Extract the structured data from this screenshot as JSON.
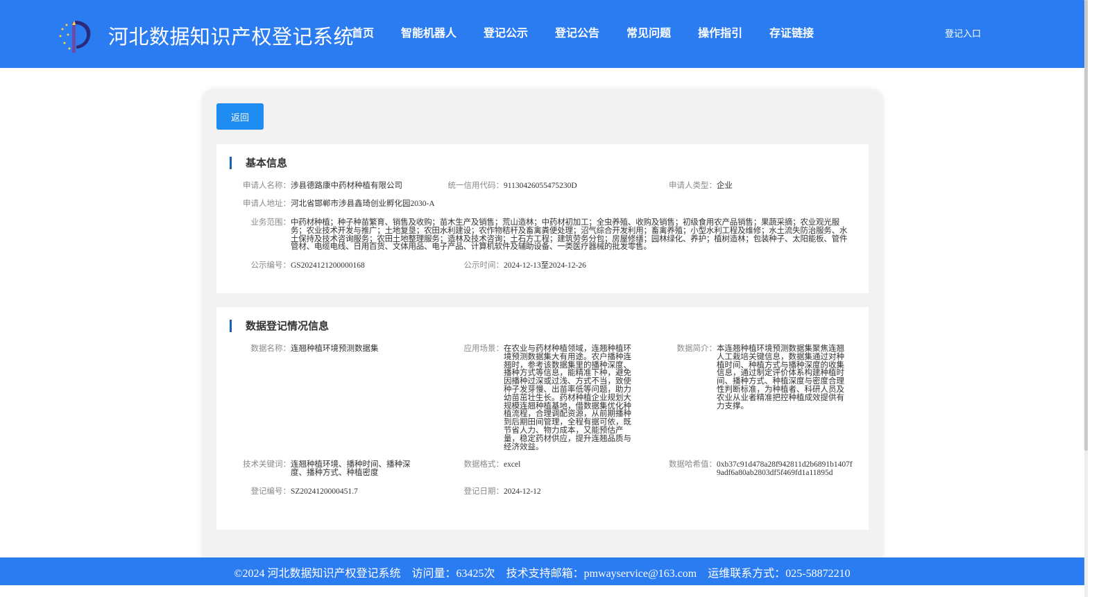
{
  "header": {
    "site_title": "河北数据知识产权登记系统",
    "nav": [
      "首页",
      "智能机器人",
      "登记公示",
      "登记公告",
      "常见问题",
      "操作指引",
      "存证链接"
    ],
    "login": "登记入口",
    "logo_icon": "logo-emblem-icon",
    "brand_color": "#2b7cf0"
  },
  "main": {
    "back_label": "返回",
    "basic": {
      "title": "基本信息",
      "applicant_name_label": "申请人名称：",
      "applicant_name": "涉县德路康中药材种植有限公司",
      "credit_code_label": "统一信用代码：",
      "credit_code": "91130426055475230D",
      "applicant_type_label": "申请人类型：",
      "applicant_type": "企业",
      "address_label": "申请人地址：",
      "address": "河北省邯郸市涉县鑫琦创业孵化园2030-A",
      "scope_label": "业务范围：",
      "scope": "中药材种植；种子种苗繁育、销售及收购；苗木生产及销售；荒山造林；中药材初加工；全虫养殖、收购及销售；初级食用农产品销售；果蔬采摘；农业观光服务；农业技术开发与推广；土地复垦；农田水利建设；农作物秸秆及畜禽粪便处理；沼气综合开发利用；畜禽养殖；小型水利工程及维修；水土流失防治服务、水土保持及技术咨询服务；农田土地整理服务；造林及技术咨询；土石方工程；建筑劳务分包；房屋修缮；园林绿化、养护；植树造林；包装种子、太阳能板、管件管材、电缆电线、日用百货、文体用品、电子产品、计算机软件及辅助设备、一类医疗器械的批发零售。",
      "notice_no_label": "公示编号：",
      "notice_no": "GS2024121200000168",
      "notice_time_label": "公示时间：",
      "notice_time": "2024-12-13至2024-12-26"
    },
    "data": {
      "title": "数据登记情况信息",
      "name_label": "数据名称：",
      "name": "连翘种植环境预测数据集",
      "scenario_label": "应用场景：",
      "scenario": "在农业与药材种植领域，连翘种植环境预测数据集大有用途。农户播种连翘时，参考该数据集里的播种深度、播种方式等信息，能精准下种，避免因播种过深或过浅、方式不当，致使种子发芽慢、出苗率低等问题，助力幼苗茁壮生长。药材种植企业规划大规模连翘种植基地，借数据集优化种植流程，合理调配资源，从前期播种到后期田间管理，全程有据可依，既节省人力、物力成本，又能预估产量，稳定药材供应，提升连翘品质与经济效益。",
      "intro_label": "数据简介：",
      "intro": "本连翘种植环境预测数据集聚焦连翘人工栽培关键信息，数据集通过对种植时间、种植方式与播种深度的收集信息，通过制定评价体系构建种植时间、播种方式、种植深度与密度合理性判断标准，为种植者、科研人员及农业从业者精准把控种植成效提供有力支撑。",
      "keywords_label": "技术关键词：",
      "keywords": "连翘种植环境、播种时间、播种深度、播种方式、种植密度",
      "format_label": "数据格式：",
      "format": "excel",
      "hash_label": "数据哈希值：",
      "hash": "0xb37c91d478a28f942811d2b6891b1407f9adf6a80ab2803df5f469fd1a11895d",
      "reg_no_label": "登记编号：",
      "reg_no": "SZ2024120000451.7",
      "reg_date_label": "登记日期：",
      "reg_date": "2024-12-12"
    }
  },
  "footer": {
    "copyright": "©2024 河北数据知识产权登记系统",
    "visits": "访问量：63425次",
    "email": "技术支持邮箱：pmwayservice@163.com",
    "phone": "运维联系方式：025-58872210"
  }
}
